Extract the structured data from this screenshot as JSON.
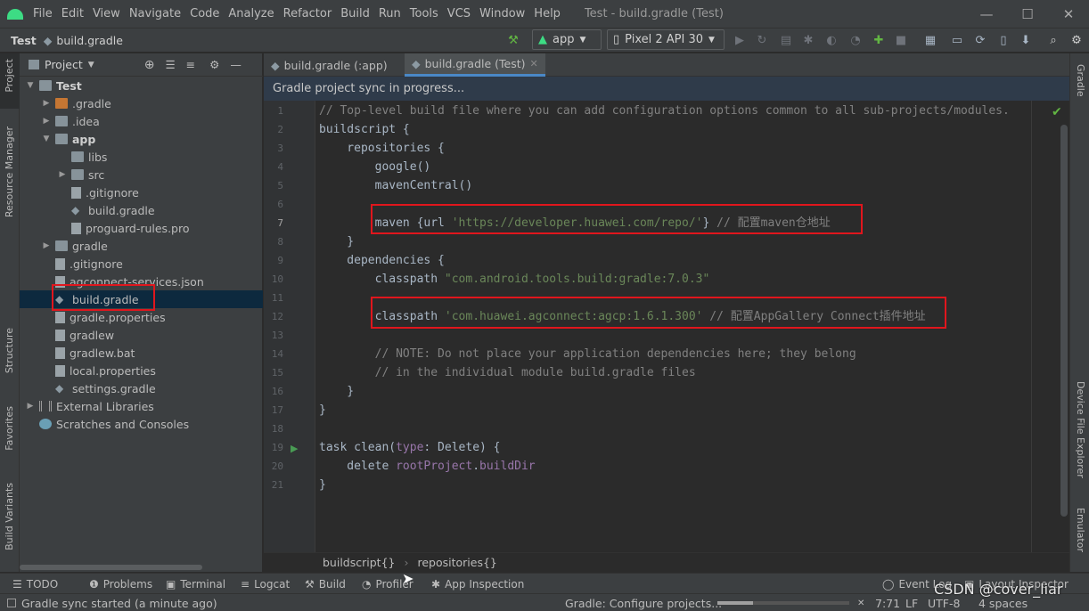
{
  "menu": {
    "items": [
      "File",
      "Edit",
      "View",
      "Navigate",
      "Code",
      "Analyze",
      "Refactor",
      "Build",
      "Run",
      "Tools",
      "VCS",
      "Window",
      "Help"
    ],
    "window_title": "Test - build.gradle (Test)"
  },
  "breadcrumb": {
    "project": "Test",
    "file": "build.gradle"
  },
  "toolbar": {
    "run_config": "app",
    "device": "Pixel 2 API 30"
  },
  "sidebar_left": {
    "project_tab": "Project",
    "resource_manager": "Resource Manager",
    "structure": "Structure",
    "favorites": "Favorites",
    "build_variants": "Build Variants"
  },
  "sidebar_right": {
    "gradle": "Gradle",
    "device_file_explorer": "Device File Explorer",
    "emulator": "Emulator"
  },
  "project_panel": {
    "title": "Project",
    "tree": [
      {
        "label": "Test",
        "depth": 0,
        "expanded": true,
        "kind": "module-root"
      },
      {
        "label": ".gradle",
        "depth": 1,
        "expanded": false,
        "kind": "folder-orange"
      },
      {
        "label": ".idea",
        "depth": 1,
        "expanded": false,
        "kind": "folder"
      },
      {
        "label": "app",
        "depth": 1,
        "expanded": true,
        "kind": "module"
      },
      {
        "label": "libs",
        "depth": 2,
        "kind": "folder"
      },
      {
        "label": "src",
        "depth": 2,
        "expanded": false,
        "kind": "folder"
      },
      {
        "label": ".gitignore",
        "depth": 2,
        "kind": "file"
      },
      {
        "label": "build.gradle",
        "depth": 2,
        "kind": "gradle"
      },
      {
        "label": "proguard-rules.pro",
        "depth": 2,
        "kind": "file"
      },
      {
        "label": "gradle",
        "depth": 1,
        "expanded": false,
        "kind": "folder"
      },
      {
        "label": ".gitignore",
        "depth": 1,
        "kind": "file"
      },
      {
        "label": "agconnect-services.json",
        "depth": 1,
        "kind": "file"
      },
      {
        "label": "build.gradle",
        "depth": 1,
        "kind": "gradle",
        "selected": true
      },
      {
        "label": "gradle.properties",
        "depth": 1,
        "kind": "file"
      },
      {
        "label": "gradlew",
        "depth": 1,
        "kind": "file"
      },
      {
        "label": "gradlew.bat",
        "depth": 1,
        "kind": "file"
      },
      {
        "label": "local.properties",
        "depth": 1,
        "kind": "file"
      },
      {
        "label": "settings.gradle",
        "depth": 1,
        "kind": "gradle"
      },
      {
        "label": "External Libraries",
        "depth": 0,
        "expanded": false,
        "kind": "libs"
      },
      {
        "label": "Scratches and Consoles",
        "depth": 0,
        "kind": "scratch"
      }
    ]
  },
  "editor": {
    "tabs": [
      {
        "label": "build.gradle (:app)",
        "active": false
      },
      {
        "label": "build.gradle (Test)",
        "active": true
      }
    ],
    "notice": "Gradle project sync in progress...",
    "current_line": 7,
    "lines": [
      [
        {
          "t": "// Top-level build file where you can add configuration options common to all sub-projects/modules.",
          "c": "cm"
        }
      ],
      [
        {
          "t": "buildscript {",
          "c": ""
        }
      ],
      [
        {
          "t": "    repositories {",
          "c": ""
        }
      ],
      [
        {
          "t": "        google()",
          "c": ""
        }
      ],
      [
        {
          "t": "        mavenCentral()",
          "c": ""
        }
      ],
      [],
      [
        {
          "t": "        maven {url ",
          "c": ""
        },
        {
          "t": "'https://developer.huawei.com/repo/'",
          "c": "st"
        },
        {
          "t": "} ",
          "c": ""
        },
        {
          "t": "// 配置maven仓地址",
          "c": "cm"
        }
      ],
      [
        {
          "t": "    }",
          "c": ""
        }
      ],
      [
        {
          "t": "    dependencies {",
          "c": ""
        }
      ],
      [
        {
          "t": "        classpath ",
          "c": ""
        },
        {
          "t": "\"com.android.tools.build:gradle:7.0.3\"",
          "c": "st"
        }
      ],
      [],
      [
        {
          "t": "        classpath ",
          "c": ""
        },
        {
          "t": "'com.huawei.agconnect:agcp:1.6.1.300'",
          "c": "st"
        },
        {
          "t": " // 配置AppGallery Connect插件地址",
          "c": "cm"
        }
      ],
      [],
      [
        {
          "t": "        // NOTE: Do not place your application dependencies here; they belong",
          "c": "cm"
        }
      ],
      [
        {
          "t": "        // in the individual module build.gradle files",
          "c": "cm"
        }
      ],
      [
        {
          "t": "    }",
          "c": ""
        }
      ],
      [
        {
          "t": "}",
          "c": ""
        }
      ],
      [],
      [
        {
          "t": "task clean(",
          "c": ""
        },
        {
          "t": "type",
          "c": "pu"
        },
        {
          "t": ": Delete) {",
          "c": ""
        }
      ],
      [
        {
          "t": "    delete ",
          "c": ""
        },
        {
          "t": "rootProject",
          "c": "pu"
        },
        {
          "t": ".",
          "c": ""
        },
        {
          "t": "buildDir",
          "c": "pu"
        }
      ],
      [
        {
          "t": "}",
          "c": ""
        }
      ]
    ],
    "breadcrumbs": [
      "buildscript{}",
      "repositories{}"
    ]
  },
  "bottom_tabs": [
    "TODO",
    "Problems",
    "Terminal",
    "Logcat",
    "Build",
    "Profiler",
    "App Inspection",
    "Event Log",
    "Layout Inspector"
  ],
  "status": {
    "left": "Gradle sync started (a minute ago)",
    "task": "Gradle: Configure projects...",
    "caret": "7:71",
    "line_sep": "LF",
    "encoding": "UTF-8",
    "indent": "4 spaces",
    "watermark": "CSDN @cover_liar"
  },
  "colors": {
    "accent": "#4a88c7",
    "highlight_box": "#e0161d",
    "android_green": "#3ddc84"
  }
}
